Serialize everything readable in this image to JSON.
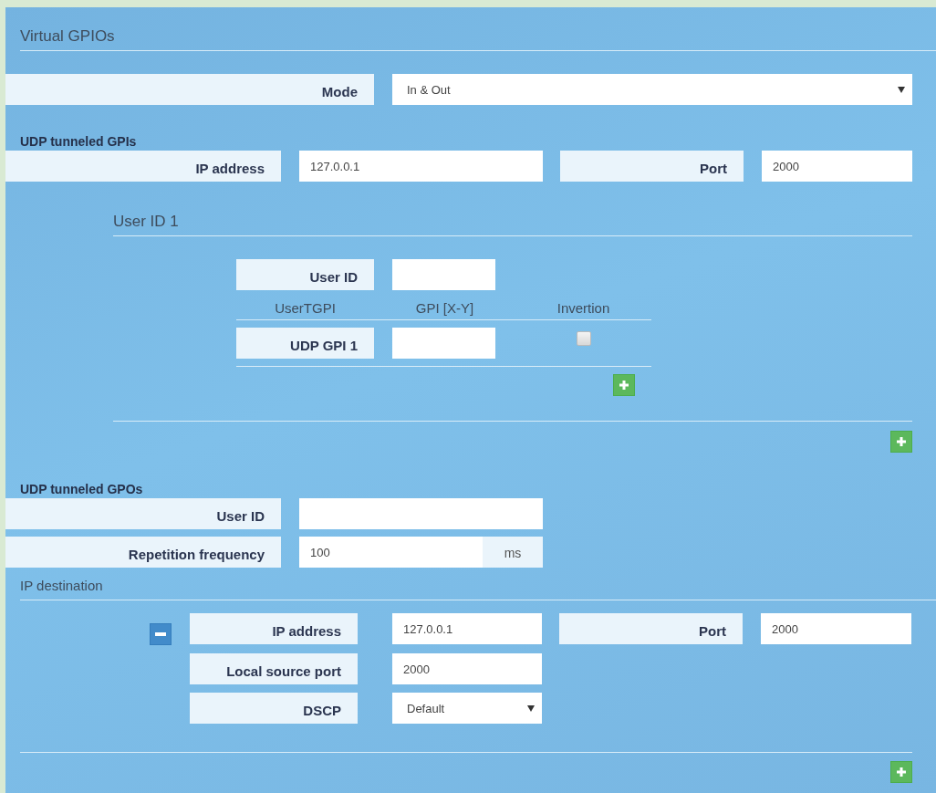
{
  "section_title": "Virtual GPIOs",
  "mode": {
    "label": "Mode",
    "value": "In & Out"
  },
  "gpis": {
    "heading": "UDP tunneled GPIs",
    "ip_label": "IP address",
    "ip_value": "127.0.0.1",
    "port_label": "Port",
    "port_value": "2000",
    "users": [
      {
        "title": "User ID 1",
        "user_id_label": "User ID",
        "columns": [
          "UserTGPI",
          "GPI [X-Y]",
          "Invertion"
        ],
        "rows": [
          {
            "label": "UDP GPI 1",
            "checked": false
          }
        ]
      }
    ]
  },
  "gpos": {
    "heading": "UDP tunneled GPOs",
    "user_id_label": "User ID",
    "freq_label": "Repetition frequency",
    "freq_value": "100",
    "freq_unit": "ms",
    "dest_title": "IP destination",
    "destinations": [
      {
        "ip_label": "IP address",
        "ip_value": "127.0.0.1",
        "port_label": "Port",
        "port_value": "2000",
        "local_label": "Local source port",
        "local_value": "2000",
        "dscp_label": "DSCP",
        "dscp_value": "Default"
      }
    ]
  }
}
